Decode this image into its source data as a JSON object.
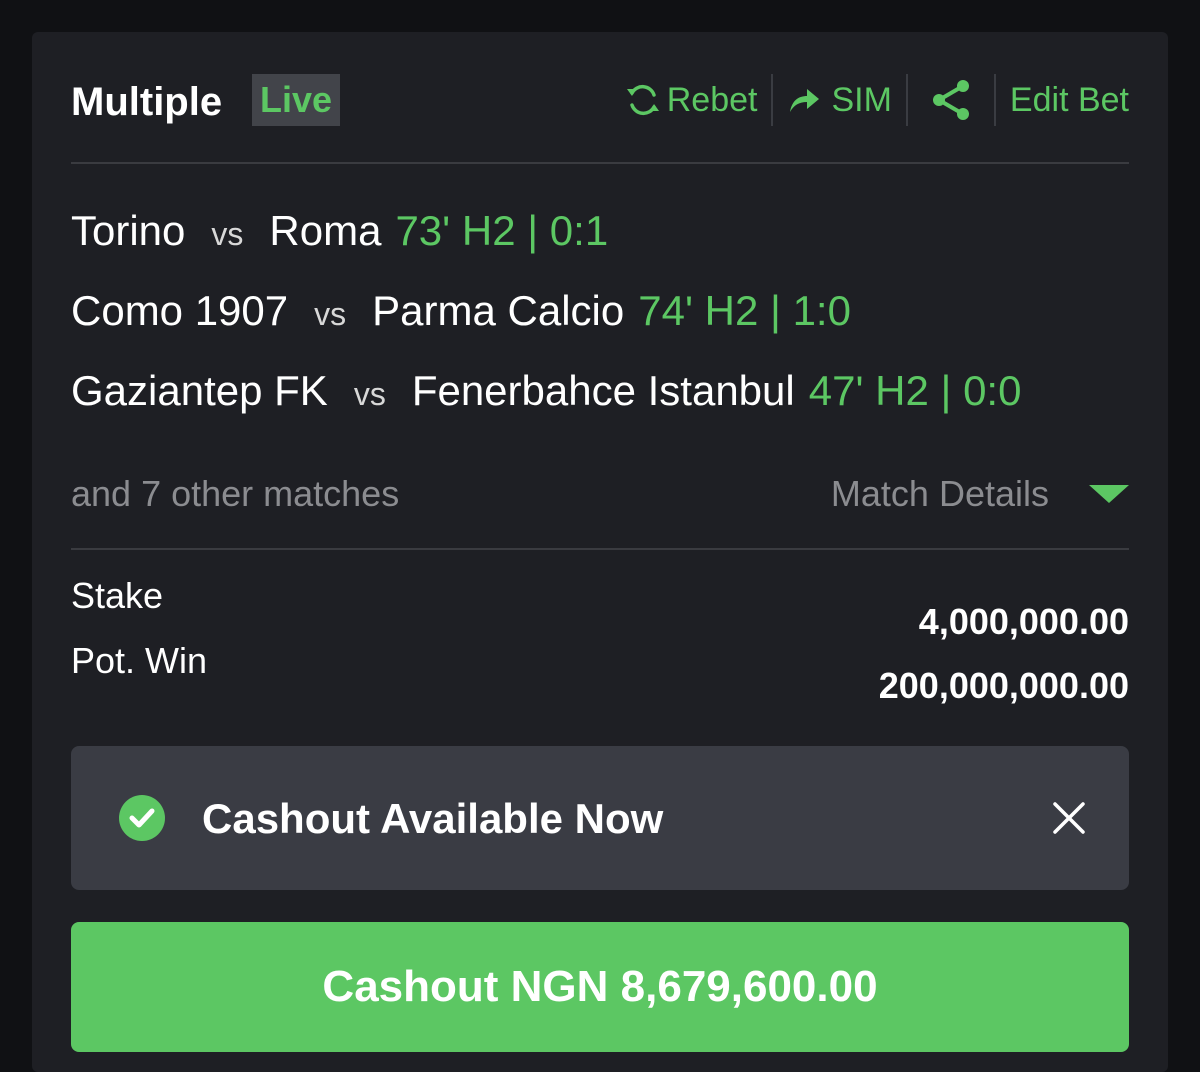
{
  "header": {
    "title": "Multiple",
    "badge": "Live",
    "actions": {
      "rebet": "Rebet",
      "sim": "SIM",
      "edit_bet": "Edit Bet"
    }
  },
  "matches": [
    {
      "home": "Torino",
      "vs": "vs",
      "away": "Roma",
      "status": "73' H2 | 0:1"
    },
    {
      "home": "Como 1907",
      "vs": "vs",
      "away": "Parma Calcio",
      "status": "74' H2 | 1:0"
    },
    {
      "home": "Gaziantep FK",
      "vs": "vs",
      "away": "Fenerbahce Istanbul",
      "status": "47' H2 | 0:0"
    }
  ],
  "more_matches": "and 7 other matches",
  "match_details_label": "Match Details",
  "stake": {
    "label": "Stake",
    "value": "4,000,000.00"
  },
  "pot_win": {
    "label": "Pot. Win",
    "value": "200,000,000.00"
  },
  "notice": {
    "text": "Cashout Available Now"
  },
  "cashout_button": "Cashout NGN 8,679,600.00",
  "colors": {
    "accent": "#5cc763",
    "background": "#1e1f24",
    "notice_bg": "#3a3c44"
  },
  "icons": {
    "rebet": "refresh-icon",
    "sim": "share-arrow-icon",
    "share": "share-icon",
    "notice": "check-circle-icon",
    "close": "close-icon",
    "details": "triangle-down-icon"
  }
}
